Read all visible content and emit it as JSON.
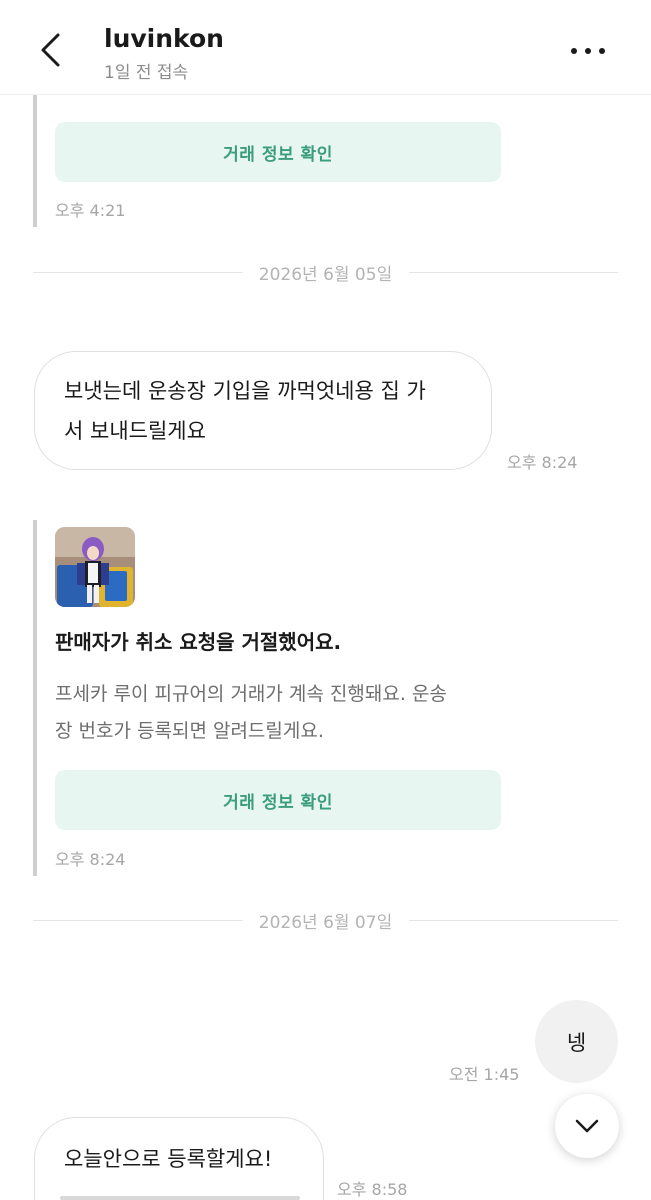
{
  "header": {
    "title": "luvinkon",
    "subtitle": "1일 전 접속",
    "back_icon": "chevron-left-icon",
    "more_icon": "more-horizontal-icon"
  },
  "messages": {
    "first_card": {
      "button_label": "거래 정보 확인",
      "time": "오후 4:21"
    },
    "date1": "2026년 6월 05일",
    "incoming1": {
      "line1": "보냇는데 운송장 기입을 까먹엇네용 집 가",
      "line2": "서 보내드릴게요",
      "time": "오후 8:24"
    },
    "cancel_card": {
      "title": "판매자가 취소 요청을 거절했어요.",
      "body_line1": "프세카 루이 피규어의 거래가 계속 진행돼요. 운송",
      "body_line2": "장 번호가 등록되면 알려드릴게요.",
      "button_label": "거래 정보 확인",
      "time": "오후 8:24"
    },
    "date2": "2026년 6월 07일",
    "outgoing1": {
      "text": "넹",
      "time": "오전 1:45"
    },
    "incoming2": {
      "text": "오늘안으로 등록할게요!",
      "time": "오후 8:58"
    }
  },
  "scroll_button_icon": "chevron-down-icon",
  "colors": {
    "accent_green": "#3a9d7d",
    "accent_green_bg": "#e8f6f1",
    "card_bar": "#cfcfcf"
  }
}
